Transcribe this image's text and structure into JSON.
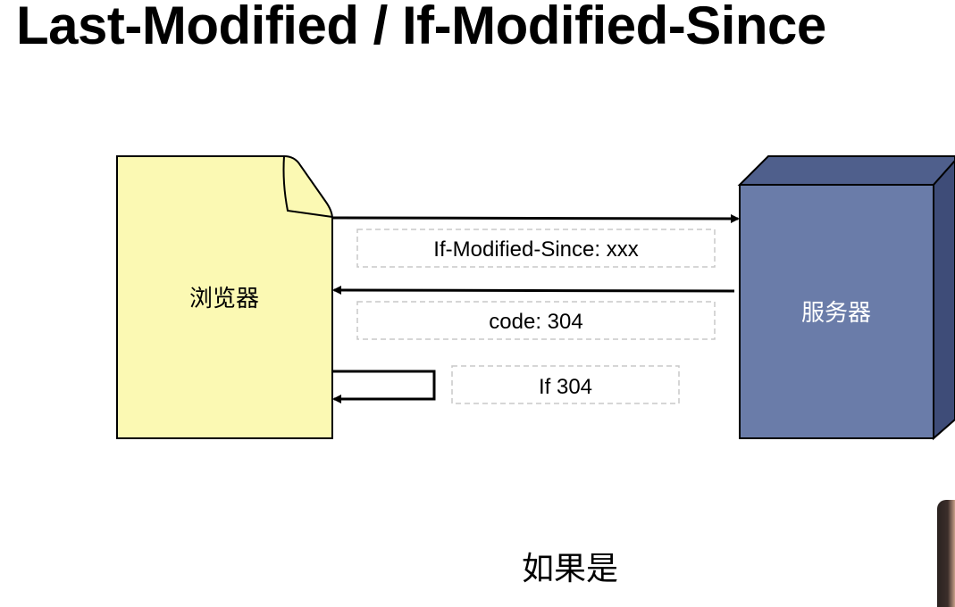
{
  "title": "Last-Modified / If-Modified-Since",
  "diagram": {
    "browser_label": "浏览器",
    "server_label": "服务器",
    "request_header": "If-Modified-Since: xxx",
    "response_code": "code: 304",
    "condition": "If 304"
  },
  "caption": "如果是",
  "colors": {
    "browser_fill": "#fbf9b3",
    "server_front": "#6a7ca9",
    "server_top": "#4f5f8c",
    "server_side": "#3e4c78",
    "box_stroke": "#000000",
    "dashed_stroke": "#c8c8c8"
  }
}
